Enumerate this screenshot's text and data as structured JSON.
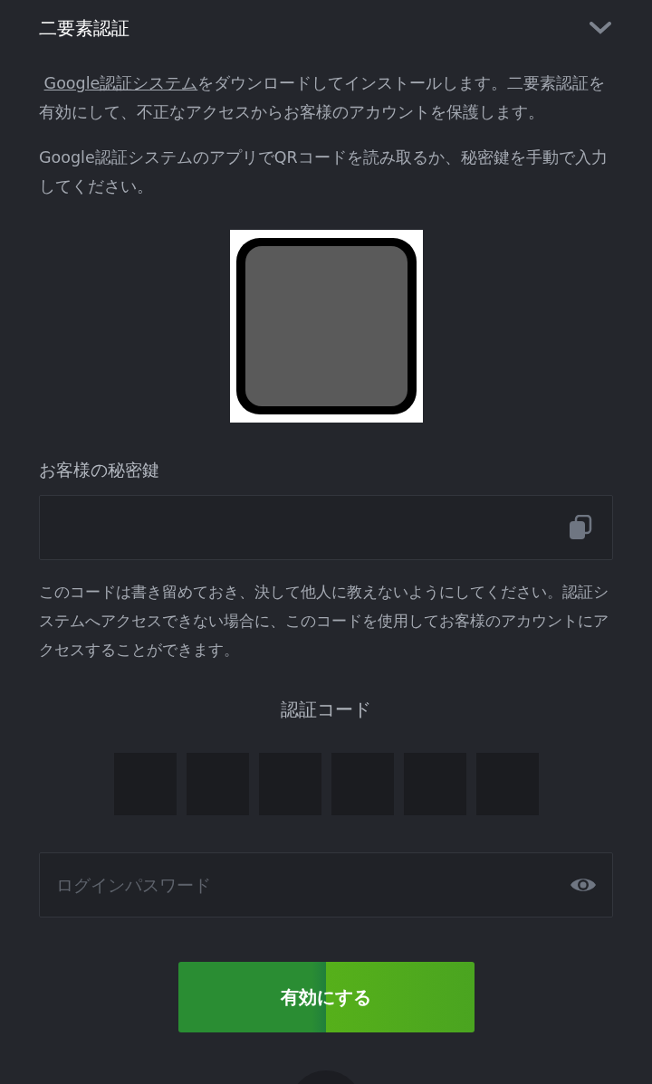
{
  "section": {
    "title": "二要素認証",
    "expanded": true
  },
  "intro": {
    "link": "Google認証システム",
    "text": "をダウンロードしてインストールします。二要素認証を有効にして、不正なアクセスからお客様のアカウントを保護します。"
  },
  "instruction": "Google認証システムのアプリでQRコードを読み取るか、秘密鍵を手動で入力してください。",
  "secret_key": {
    "label": "お客様の秘密鍵"
  },
  "note": "このコードは書き留めておき、決して他人に教えないようにしてください。認証システムへアクセスできない場合に、このコードを使用してお客様のアカウントにアクセスすることができます。",
  "auth_code": {
    "label": "認証コード",
    "boxes": [
      {
        "kind": "digit"
      },
      {
        "kind": "digit"
      },
      {
        "kind": "digit"
      },
      {
        "kind": "digit"
      },
      {
        "kind": "digit"
      },
      {
        "kind": "digit"
      }
    ]
  },
  "password": {
    "placeholder": "ログインパスワード"
  },
  "submit": {
    "label": "有効にする"
  }
}
